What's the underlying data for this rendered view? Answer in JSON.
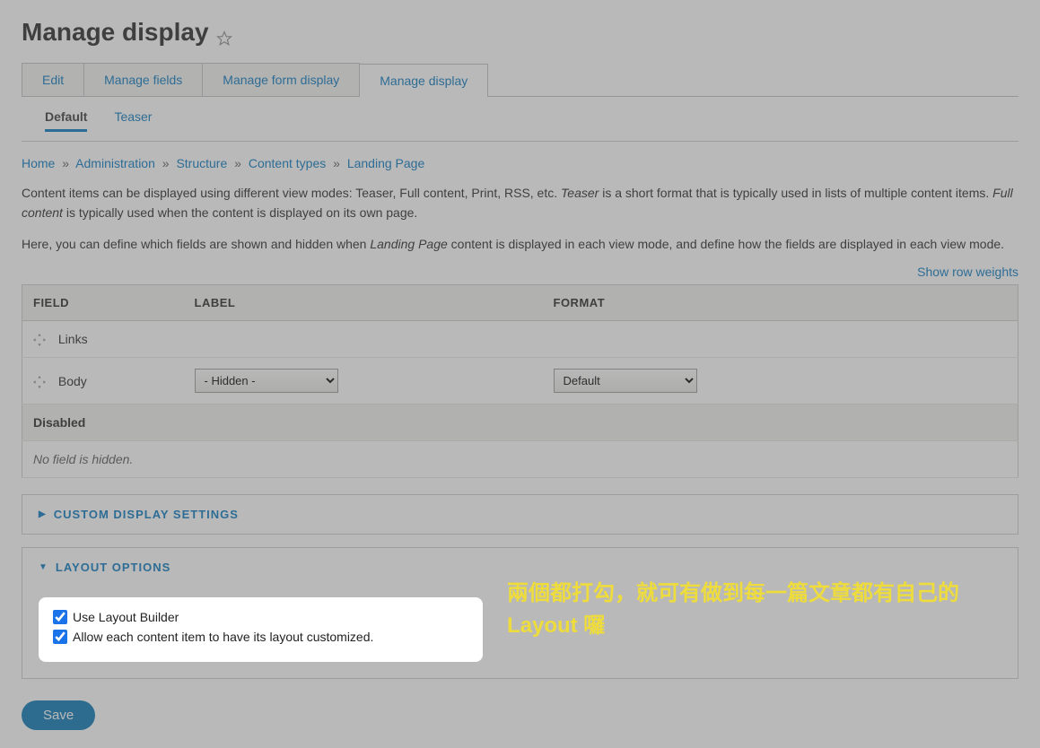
{
  "page_title": "Manage display",
  "primary_tabs": {
    "edit": "Edit",
    "manage_fields": "Manage fields",
    "manage_form": "Manage form display",
    "manage_display": "Manage display"
  },
  "secondary_tabs": {
    "default": "Default",
    "teaser": "Teaser"
  },
  "breadcrumb": {
    "home": "Home",
    "administration": "Administration",
    "structure": "Structure",
    "content_types": "Content types",
    "landing_page": "Landing Page",
    "sep": "»"
  },
  "desc": {
    "p1a": "Content items can be displayed using different view modes: Teaser, Full content, Print, RSS, etc. ",
    "p1_em1": "Teaser",
    "p1b": " is a short format that is typically used in lists of multiple content items. ",
    "p1_em2": "Full content",
    "p1c": " is typically used when the content is displayed on its own page.",
    "p2a": "Here, you can define which fields are shown and hidden when ",
    "p2_em": "Landing Page",
    "p2b": " content is displayed in each view mode, and define how the fields are displayed in each view mode."
  },
  "show_row_weights": "Show row weights",
  "table": {
    "th_field": "FIELD",
    "th_label": "LABEL",
    "th_format": "FORMAT",
    "links": "Links",
    "body": "Body",
    "label_hidden": "- Hidden -",
    "format_default": "Default",
    "disabled": "Disabled",
    "no_hidden": "No field is hidden."
  },
  "custom_display": "CUSTOM DISPLAY SETTINGS",
  "layout_options": "LAYOUT OPTIONS",
  "layout": {
    "use_builder": "Use Layout Builder",
    "allow_each": "Allow each content item to have its layout customized."
  },
  "annotation": "兩個都打勾，就可有做到每一篇文章都有自己的 Layout 囉",
  "save": "Save"
}
